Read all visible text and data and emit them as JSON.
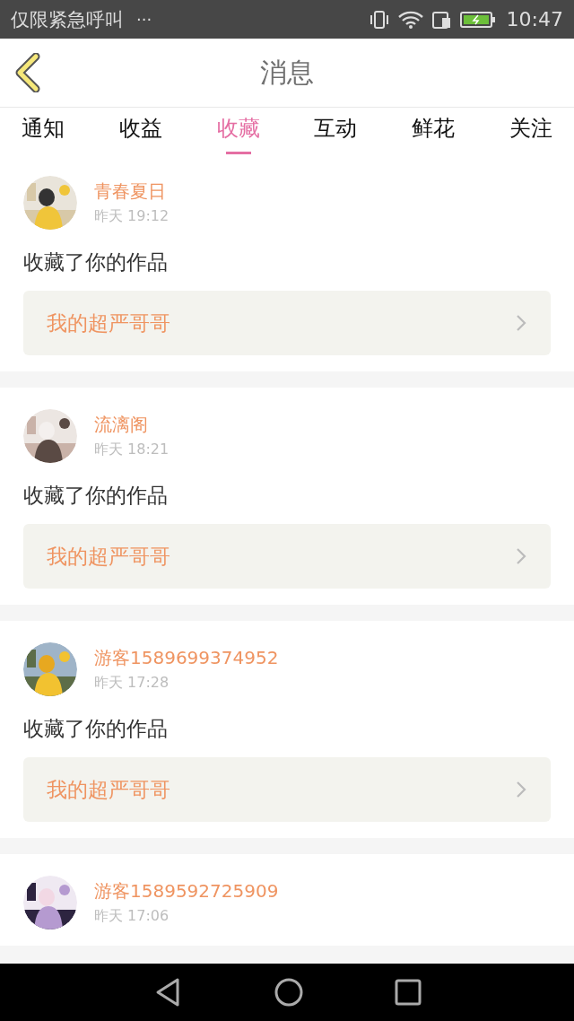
{
  "status_bar": {
    "carrier": "仅限紧急呼叫",
    "more": "···",
    "time": "10:47"
  },
  "header": {
    "title": "消息"
  },
  "tabs": [
    {
      "label": "通知",
      "selected": false
    },
    {
      "label": "收益",
      "selected": false
    },
    {
      "label": "收藏",
      "selected": true
    },
    {
      "label": "互动",
      "selected": false
    },
    {
      "label": "鲜花",
      "selected": false
    },
    {
      "label": "关注",
      "selected": false
    }
  ],
  "messages": [
    {
      "user": "青春夏日",
      "time": "昨天 19:12",
      "text": "收藏了你的作品",
      "work": "我的超严哥哥"
    },
    {
      "user": "流漓阁",
      "time": "昨天 18:21",
      "text": "收藏了你的作品",
      "work": "我的超严哥哥"
    },
    {
      "user": "游客1589699374952",
      "time": "昨天 17:28",
      "text": "收藏了你的作品",
      "work": "我的超严哥哥"
    },
    {
      "user": "游客1589592725909",
      "time": "昨天 17:06"
    }
  ]
}
